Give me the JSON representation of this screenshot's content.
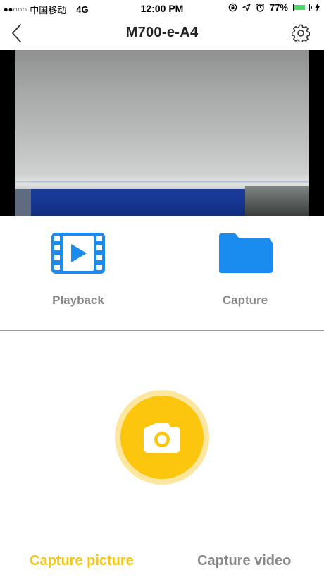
{
  "status_bar": {
    "signal_dots": "●●○○○",
    "carrier": "中国移动",
    "network": "4G",
    "time": "12:00 PM",
    "battery_percent": "77%",
    "battery_level": 0.77,
    "icons": [
      "screen-lock-icon",
      "location-arrow-icon",
      "alarm-icon",
      "battery-icon",
      "charging-bolt-icon"
    ]
  },
  "nav": {
    "title": "M700-e-A4",
    "back_icon": "chevron-left-icon",
    "settings_icon": "gear-icon"
  },
  "preview": {
    "icon": "live-camera-preview"
  },
  "actions": [
    {
      "label": "Playback",
      "icon": "film-play-icon",
      "color": "#1a8cf0"
    },
    {
      "label": "Capture",
      "icon": "folder-icon",
      "color": "#1a8cf0"
    }
  ],
  "shutter": {
    "icon": "camera-icon",
    "color": "#fbc60d",
    "ring_color": "#fde7a0"
  },
  "modes": {
    "picture_label": "Capture picture",
    "video_label": "Capture video",
    "active": "picture",
    "active_color": "#f6c514",
    "inactive_color": "#888888"
  }
}
